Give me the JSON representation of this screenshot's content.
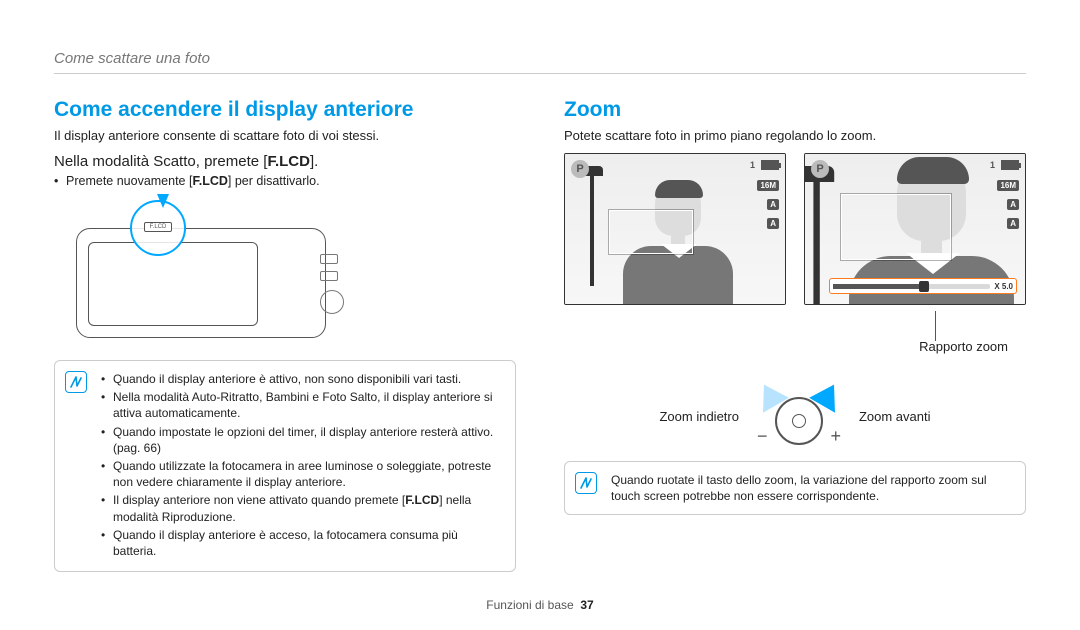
{
  "breadcrumb": "Come scattare una foto",
  "left": {
    "title": "Come accendere il display anteriore",
    "intro": "Il display anteriore consente di scattare foto di voi stessi.",
    "subhead_prefix": "Nella modalità Scatto, premete [",
    "subhead_bold": "F.LCD",
    "subhead_suffix": "].",
    "bullet1_prefix": "Premete nuovamente [",
    "bullet1_bold": "F.LCD",
    "bullet1_suffix": "] per disattivarlo.",
    "flcd_label": "F.LCD",
    "notes": {
      "n1": "Quando il display anteriore è attivo, non sono disponibili vari tasti.",
      "n2": "Nella modalità Auto-Ritratto, Bambini e Foto Salto, il display anteriore si attiva automaticamente.",
      "n3": "Quando impostate le opzioni del timer, il display anteriore resterà attivo. (pag. 66)",
      "n4": "Quando utilizzate la fotocamera in aree luminose o soleggiate, potreste non vedere chiaramente il display anteriore.",
      "n5_prefix": "Il display anteriore non viene attivato quando premete [",
      "n5_bold": "F.LCD",
      "n5_suffix": "] nella modalità Riproduzione.",
      "n6": "Quando il display anteriore è acceso, la fotocamera consuma più batteria."
    }
  },
  "right": {
    "title": "Zoom",
    "intro": "Potete scattare foto in primo piano regolando lo zoom.",
    "hud": {
      "mode": "P",
      "count": "1",
      "res": "16M",
      "flash_auto": "A",
      "macro_auto": "A"
    },
    "zoom_value": "X 5.0",
    "zoom_ratio_label": "Rapporto zoom",
    "zoom_out_label": "Zoom indietro",
    "zoom_in_label": "Zoom avanti",
    "note": "Quando ruotate il tasto dello zoom, la variazione del rapporto zoom sul touch screen potrebbe non essere corrispondente."
  },
  "footer": {
    "section": "Funzioni di base",
    "page": "37"
  }
}
